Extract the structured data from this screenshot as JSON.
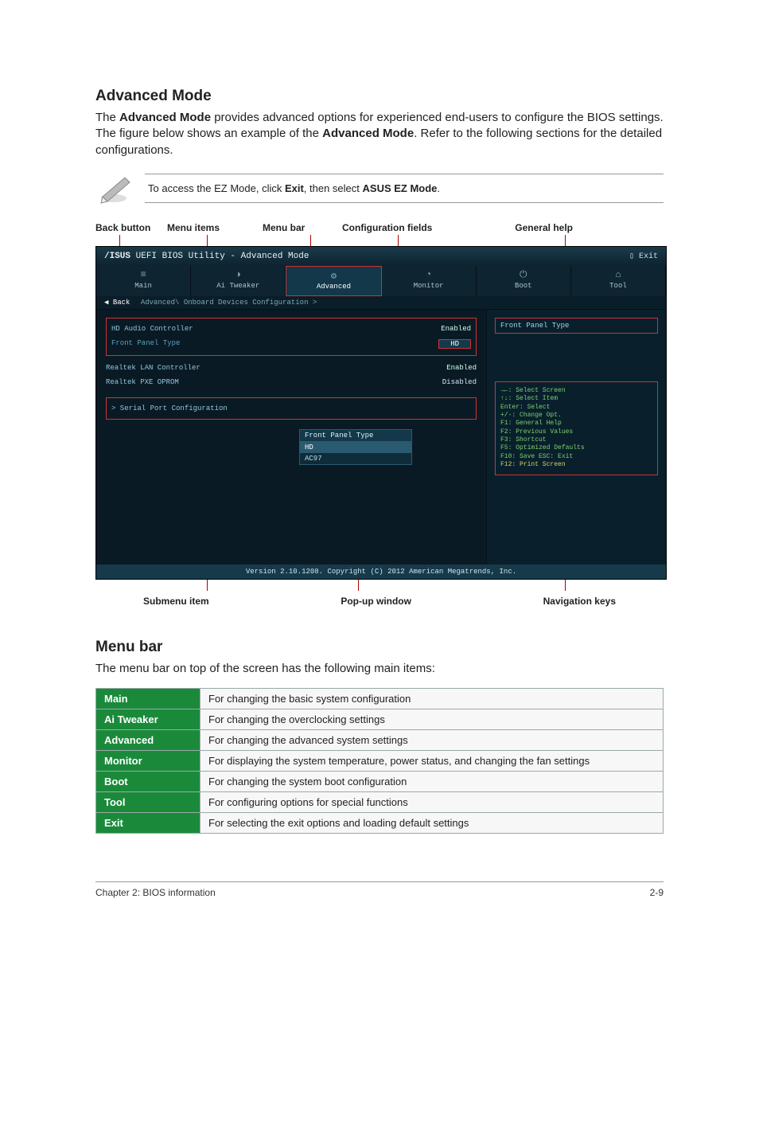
{
  "section1": {
    "title": "Advanced Mode",
    "para_parts": [
      "The ",
      "Advanced Mode",
      " provides advanced options for experienced end-users to configure the BIOS settings. The figure below shows an example of the ",
      "Advanced Mode",
      ". Refer to the following sections for the detailed configurations."
    ]
  },
  "note": {
    "parts": [
      "To access the EZ Mode, click ",
      "Exit",
      ", then select ",
      "ASUS EZ Mode",
      "."
    ]
  },
  "callouts_top": {
    "back_button": "Back button",
    "menu_items": "Menu items",
    "menu_bar": "Menu bar",
    "config_fields": "Configuration fields",
    "general_help": "General help"
  },
  "callouts_bottom": {
    "submenu_item": "Submenu item",
    "popup_window": "Pop-up window",
    "nav_keys": "Navigation keys"
  },
  "bios": {
    "title_prefix": "/ISUS",
    "title_rest": " UEFI BIOS Utility - Advanced Mode",
    "exit_label": "Exit",
    "tabs": [
      {
        "icon": "≡",
        "label": "Main"
      },
      {
        "icon": "◑",
        "label": "Ai Tweaker"
      },
      {
        "icon": "⚙",
        "label": "Advanced"
      },
      {
        "icon": "◔",
        "label": "Monitor"
      },
      {
        "icon": "⏻",
        "label": "Boot"
      },
      {
        "icon": "⌂",
        "label": "Tool"
      }
    ],
    "active_tab_index": 2,
    "back_label": "Back",
    "breadcrumb": "Advanced\\ Onboard Devices Configuration >",
    "config_rows": [
      {
        "label": "HD Audio Controller",
        "value": "Enabled",
        "group": 1
      },
      {
        "label": "Front Panel Type",
        "value": "HD",
        "group": 1,
        "highlight": true
      },
      {
        "label": "Realtek LAN Controller",
        "value": "Enabled",
        "group": 0
      },
      {
        "label": "Realtek PXE OPROM",
        "value": "Disabled",
        "group": 0
      },
      {
        "label": "> Serial Port Configuration",
        "value": "",
        "group": 2
      }
    ],
    "popup": {
      "title": "Front Panel Type",
      "items": [
        "HD",
        "AC97"
      ],
      "selected_index": 0
    },
    "help_title": "Front Panel Type",
    "nav_keys_lines": [
      "→←: Select Screen",
      "↑↓: Select Item",
      "Enter: Select",
      "+/-: Change Opt.",
      "F1: General Help",
      "F2: Previous Values",
      "F3: Shortcut",
      "F5: Optimized Defaults",
      "F10: Save  ESC: Exit",
      "F12: Print Screen"
    ],
    "footer": "Version 2.10.1208. Copyright (C) 2012 American Megatrends, Inc."
  },
  "section2": {
    "title": "Menu bar",
    "intro": "The menu bar on top of the screen has the following main items:",
    "rows": [
      {
        "key": "Main",
        "desc": "For changing the basic system configuration"
      },
      {
        "key": "Ai Tweaker",
        "desc": "For changing the overclocking settings"
      },
      {
        "key": "Advanced",
        "desc": "For changing the advanced system settings"
      },
      {
        "key": "Monitor",
        "desc": "For displaying the system temperature, power status, and changing the fan settings"
      },
      {
        "key": "Boot",
        "desc": "For changing the system boot configuration"
      },
      {
        "key": "Tool",
        "desc": "For configuring options for special functions"
      },
      {
        "key": "Exit",
        "desc": "For selecting the exit options and loading default settings"
      }
    ]
  },
  "page_footer": {
    "left": "Chapter 2: BIOS information",
    "right": "2-9"
  }
}
